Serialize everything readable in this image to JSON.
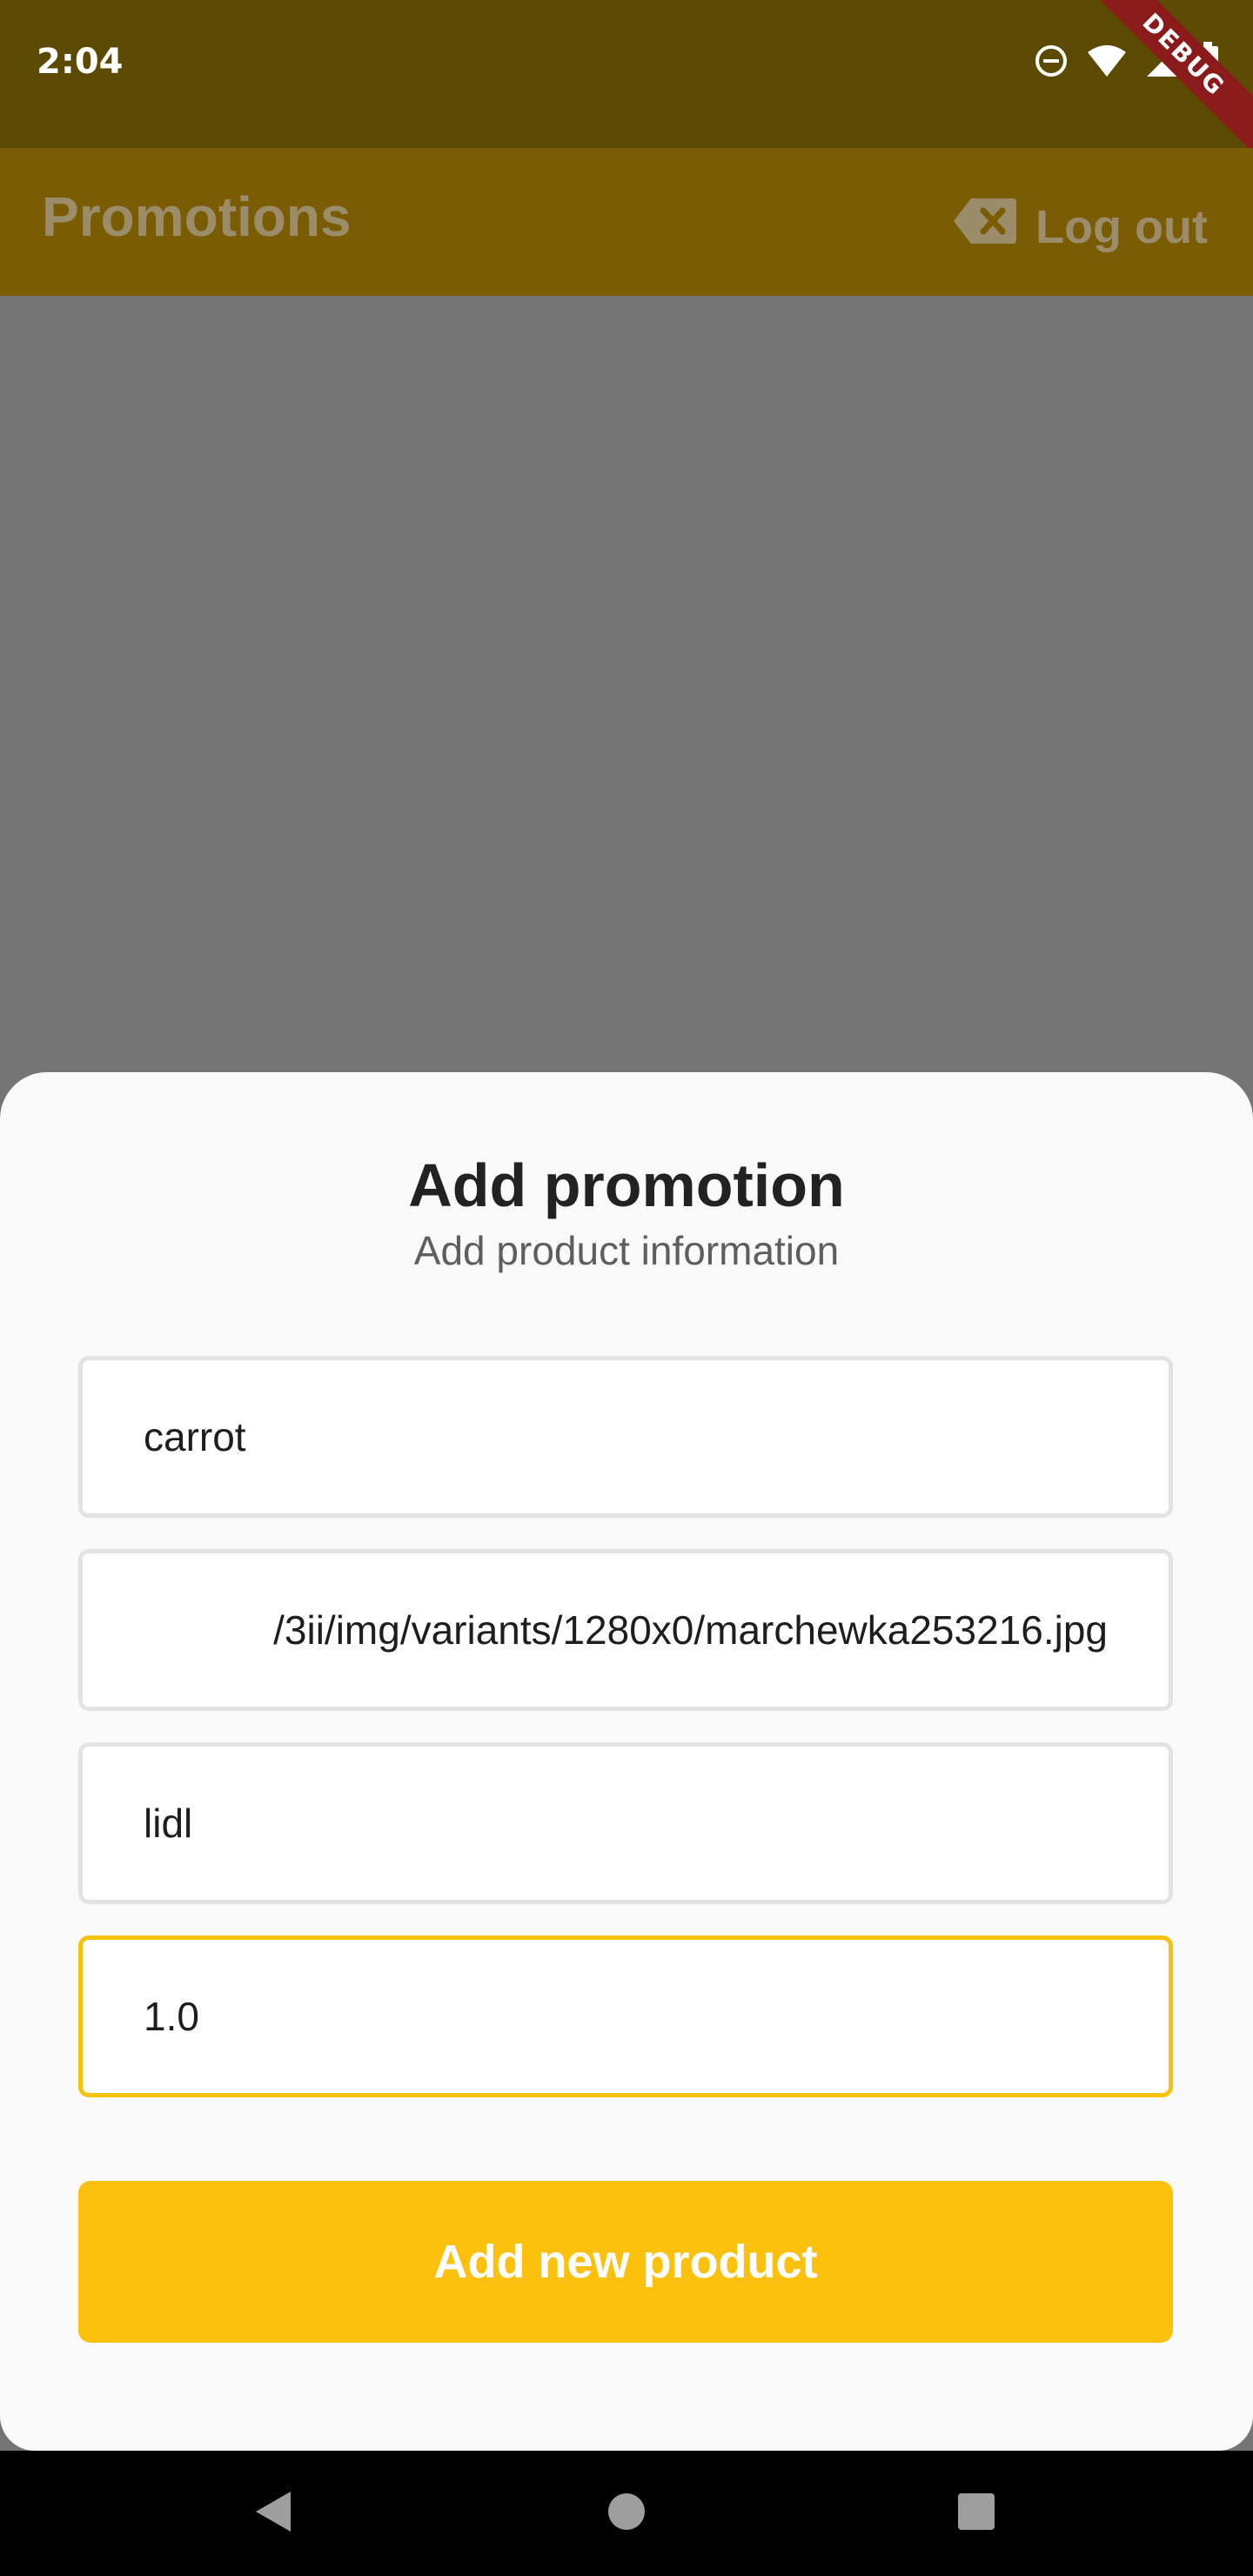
{
  "status_bar": {
    "time": "2:04",
    "debug_label": "DEBUG",
    "icons": [
      "do-not-disturb-icon",
      "wifi-icon",
      "signal-icon",
      "battery-icon"
    ]
  },
  "app_bar": {
    "title": "Promotions",
    "logout_label": "Log out",
    "logout_icon": "backspace-icon"
  },
  "sheet": {
    "title": "Add promotion",
    "subtitle": "Add product information",
    "fields": [
      {
        "name": "product-name",
        "value": "carrot"
      },
      {
        "name": "image-url",
        "value": "/3ii/img/variants/1280x0/marchewka253216.jpg"
      },
      {
        "name": "store",
        "value": "lidl"
      },
      {
        "name": "price",
        "value": "1.0"
      }
    ],
    "submit_label": "Add new product"
  },
  "colors": {
    "accent": "#fbc10c",
    "focused_border": "#f6c20c",
    "scrim": "#757575"
  },
  "nav_bar": {
    "icons": [
      "back-icon",
      "home-icon",
      "recents-icon"
    ]
  }
}
